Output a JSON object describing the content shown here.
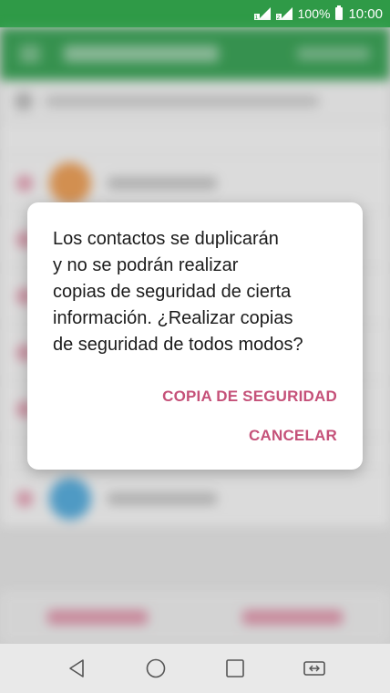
{
  "status_bar": {
    "battery_percent": "100%",
    "time": "10:00",
    "icons": [
      "signal-sim1-icon",
      "signal-sim2-icon",
      "battery-icon"
    ]
  },
  "dialog": {
    "message": "Los contactos se duplicarán\ny no se podrán realizar\ncopias de seguridad de cierta\ninformación. ¿Realizar copias\nde seguridad de todos modos?",
    "primary_button": "COPIA DE SEGURIDAD",
    "cancel_button": "CANCELAR",
    "accent_color": "#c55179"
  },
  "nav_bar": {
    "icons": [
      "back-icon",
      "home-icon",
      "recents-icon",
      "dual-window-icon"
    ]
  }
}
